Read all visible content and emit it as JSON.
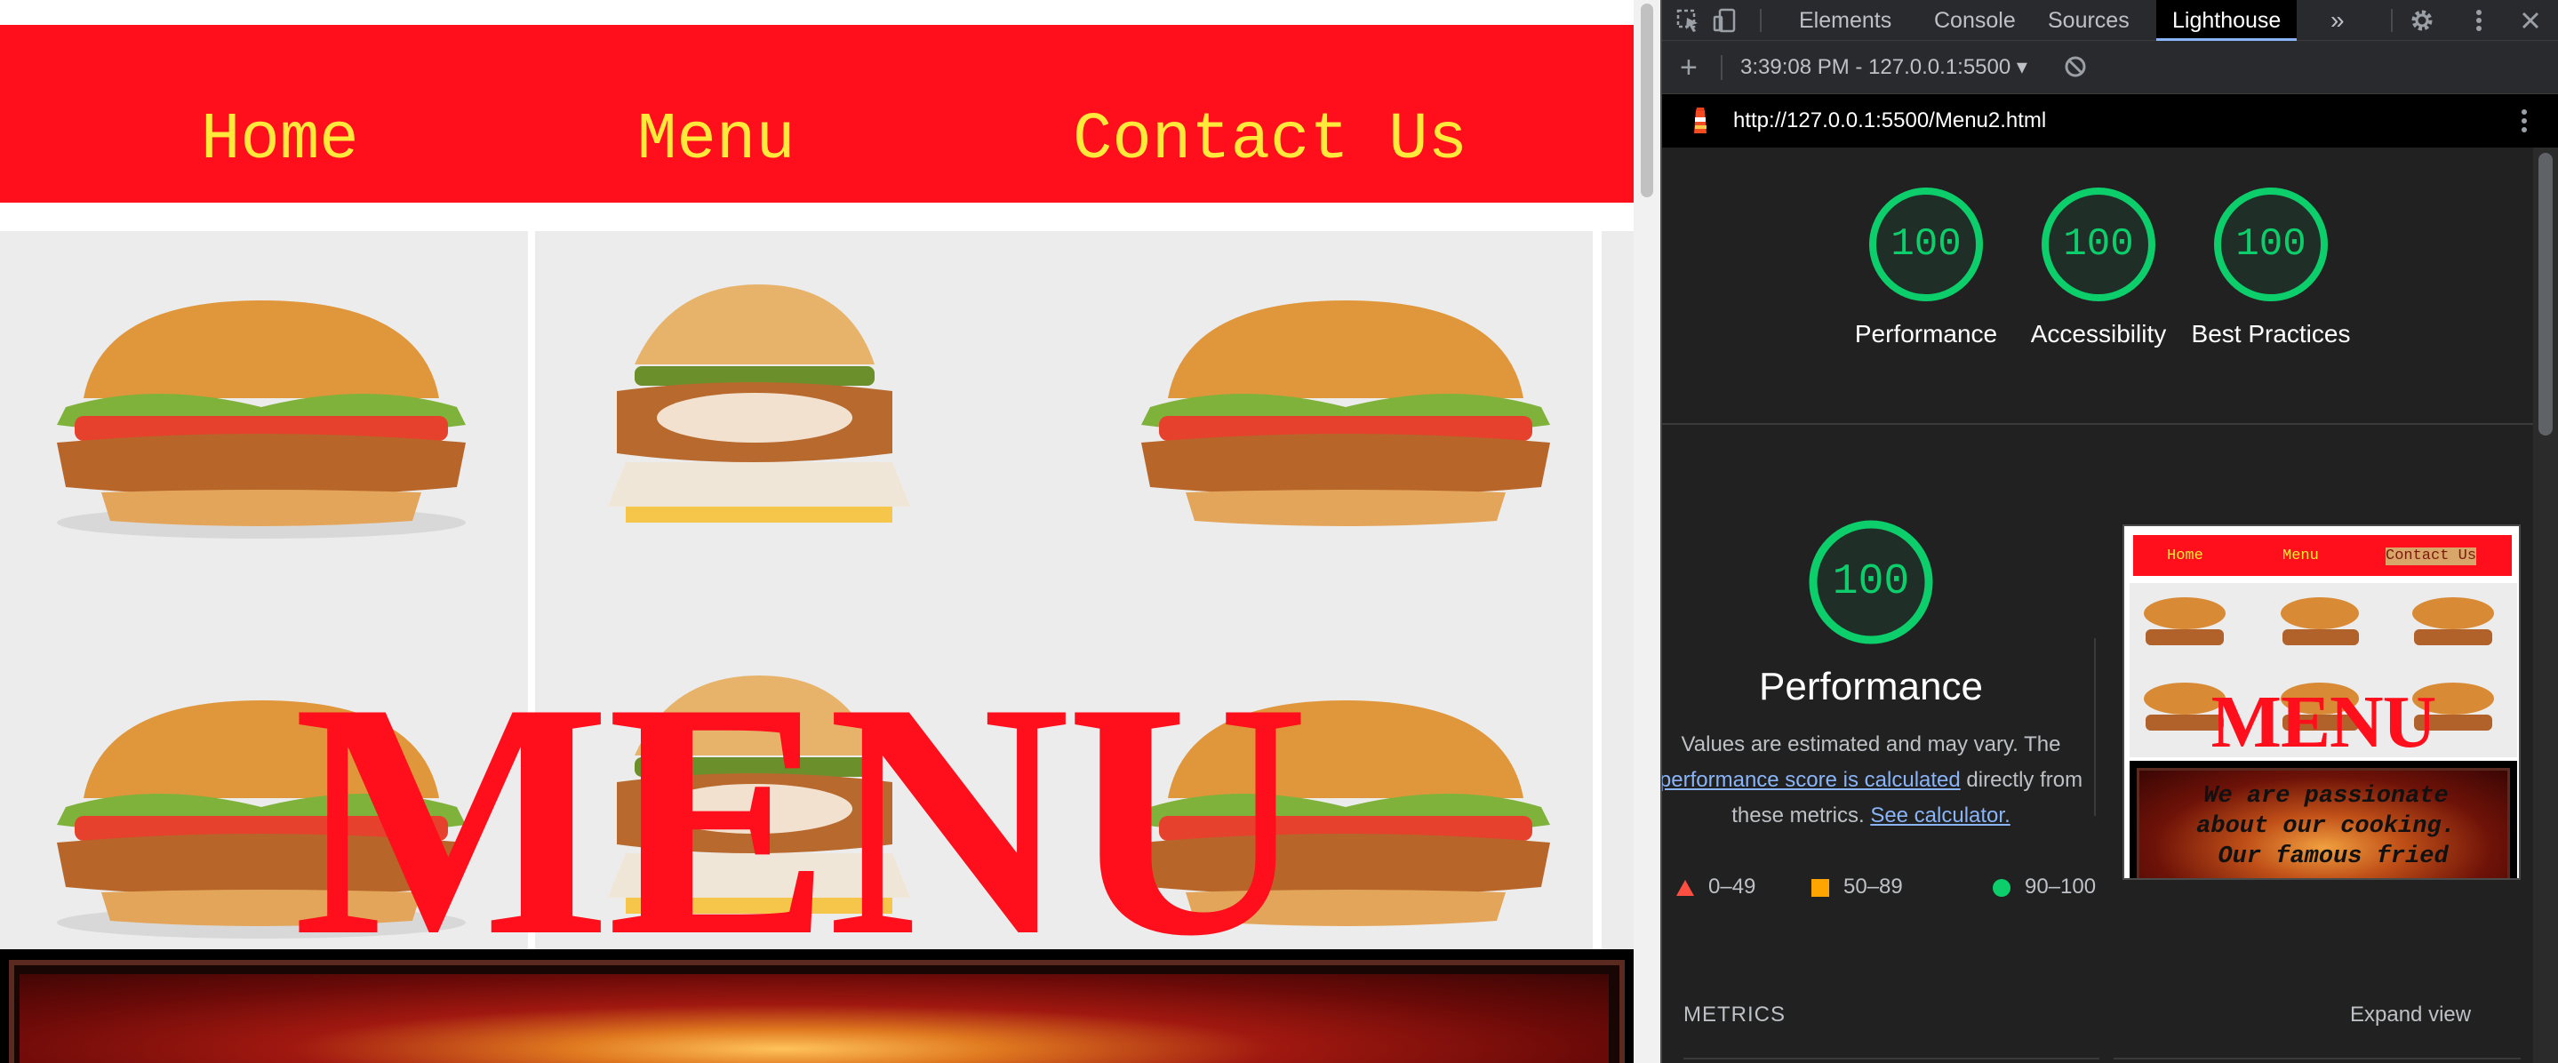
{
  "site": {
    "nav": {
      "home": "Home",
      "menu": "Menu",
      "contact": "Contact Us"
    },
    "hero_title": "MENU",
    "colors": {
      "brand_red": "#ff0e1c",
      "nav_text": "#ffe93a"
    }
  },
  "devtools": {
    "tabs": {
      "elements": "Elements",
      "console": "Console",
      "sources": "Sources",
      "lighthouse": "Lighthouse",
      "more": "»"
    },
    "icons": [
      "inspect-icon",
      "device-toggle-icon",
      "settings-gear-icon",
      "kebab-menu-icon",
      "close-icon"
    ],
    "toolbar": {
      "new_report": "+",
      "report_select": "3:39:08 PM - 127.0.0.1:5500 ▾"
    },
    "url": "http://127.0.0.1:5500/Menu2.html"
  },
  "lighthouse": {
    "summary": [
      {
        "label": "Performance",
        "score": 100
      },
      {
        "label": "Accessibility",
        "score": 100
      },
      {
        "label": "Best Practices",
        "score": 100
      }
    ],
    "performance": {
      "score": 100,
      "title": "Performance",
      "desc_before": "Values are estimated and may vary. The",
      "desc_link1": "performance score is calculated",
      "desc_middle": "directly from these metrics.",
      "desc_link2": "See calculator."
    },
    "legend": {
      "fail": "0–49",
      "average": "50–89",
      "pass": "90–100"
    },
    "legend_colors": {
      "fail": "#ff4e42",
      "average": "#ffa400",
      "pass": "#0cce6b"
    },
    "screenshot": {
      "nav": {
        "home": "Home",
        "menu": "Menu",
        "contact": "Contact Us"
      },
      "title": "MENU",
      "about_text": "We are passionate\nabout our cooking.\n Our famous fried\n"
    },
    "metrics_heading": "METRICS",
    "expand_view": "Expand view"
  }
}
